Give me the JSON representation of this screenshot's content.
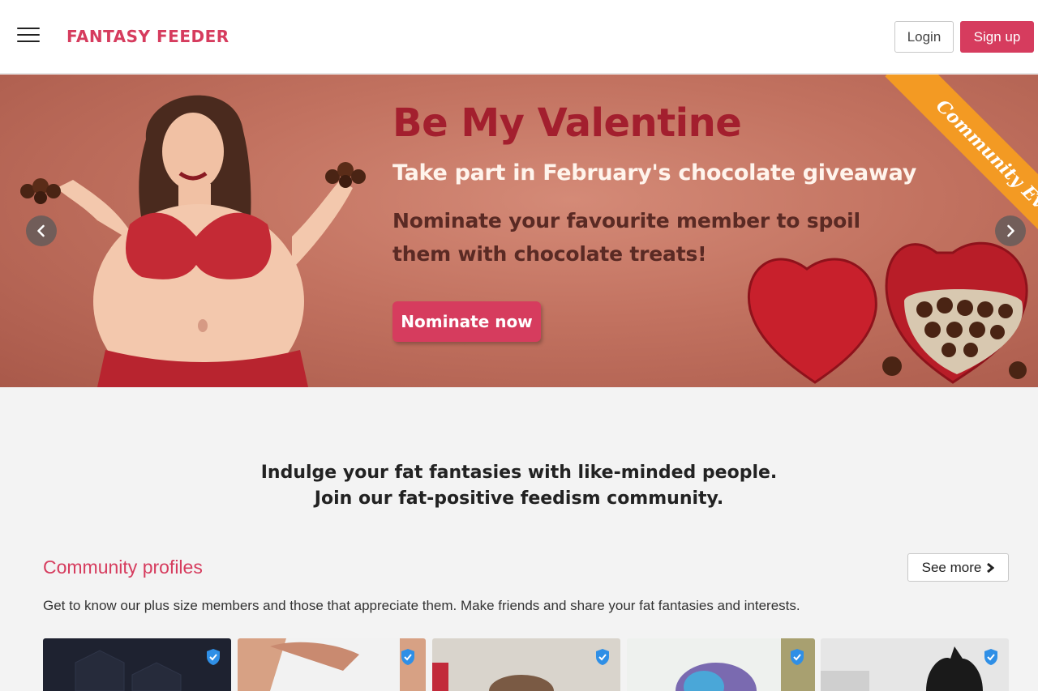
{
  "header": {
    "logo": "FANTASY FEEDER",
    "login_label": "Login",
    "signup_label": "Sign up",
    "brand_color": "#d63c5e"
  },
  "banner": {
    "title": "Be My Valentine",
    "subtitle": "Take part in February's chocolate giveaway",
    "description": "Nominate your favourite member to spoil them with chocolate treats!",
    "button_label": "Nominate now",
    "ribbon": "Community Event",
    "prev_icon": "chevron-left-icon",
    "next_icon": "chevron-right-icon"
  },
  "intro": {
    "line1": "Indulge your fat fantasies with like-minded people.",
    "line2": "Join our fat-positive feedism community."
  },
  "community": {
    "title": "Community profiles",
    "see_more_label": "See more",
    "description": "Get to know our plus size members and those that appreciate them. Make friends and share your fat fantasies and interests.",
    "profiles": [
      {
        "verified": true,
        "bg": "#1e2230"
      },
      {
        "verified": true,
        "bg": "#c98a70"
      },
      {
        "verified": true,
        "bg": "#c9c4bb"
      },
      {
        "verified": true,
        "bg": "#e6ece9"
      },
      {
        "verified": true,
        "bg": "#e3e3e3"
      }
    ]
  }
}
